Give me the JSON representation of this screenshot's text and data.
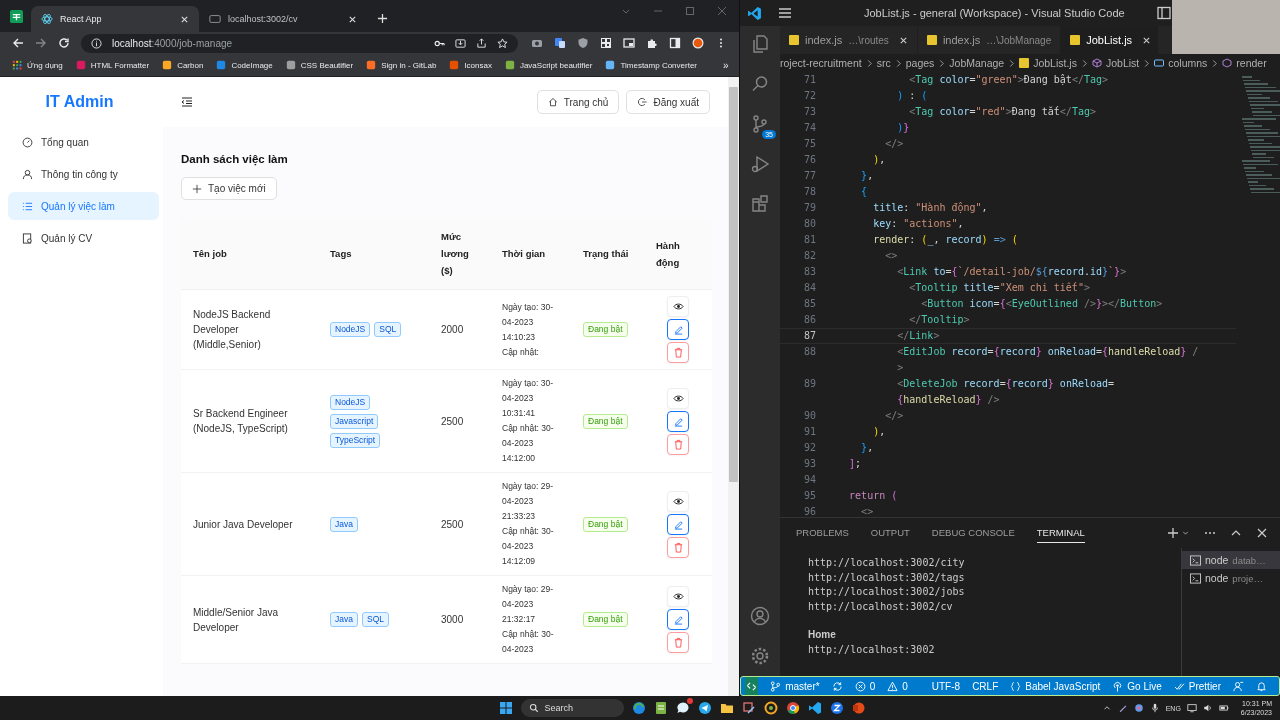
{
  "browser": {
    "tabs": [
      {
        "title": "React App",
        "selected": true
      },
      {
        "title": "localhost:3002/cv",
        "selected": false
      }
    ],
    "address": {
      "host": "localhost",
      "path": ":4000/job-manage"
    },
    "bookmarks": [
      "Ứng dụng",
      "HTML Formatter",
      "Carbon",
      "CodeImage",
      "CSS Beautifier",
      "Sign in - GitLab",
      "Iconsax",
      "JavaScript beautifier",
      "Timestamp Converter"
    ],
    "bookmarks_more": "»"
  },
  "app": {
    "logo": "IT Admin",
    "header_buttons": [
      "Trang chủ",
      "Đăng xuất"
    ],
    "sidebar": [
      {
        "label": "Tổng quan",
        "selected": false
      },
      {
        "label": "Thông tin công ty",
        "selected": false
      },
      {
        "label": "Quản lý việc làm",
        "selected": true
      },
      {
        "label": "Quản lý CV",
        "selected": false
      }
    ],
    "title": "Danh sách việc làm",
    "create_button": "Tạo việc mới",
    "table": {
      "columns": [
        "Tên job",
        "Tags",
        "Mức lương ($)",
        "Thời gian",
        "Trạng thái",
        "Hành động"
      ],
      "rows": [
        {
          "name": "NodeJS Backend Developer (Middle,Senior)",
          "tags": [
            "NodeJS",
            "SQL"
          ],
          "salary": "2000",
          "created": "Ngày tạo: 30-04-2023 14:10:23",
          "updated": "Cập nhật:",
          "status": "Đang bật",
          "enabled": true
        },
        {
          "name": "Sr Backend Engineer (NodeJS, TypeScript)",
          "tags": [
            "NodeJS",
            "Javascript",
            "TypeScript"
          ],
          "salary": "2500",
          "created": "Ngày tạo: 30-04-2023 10:31:41",
          "updated": "Cập nhật: 30-04-2023 14:12:00",
          "status": "Đang bật",
          "enabled": true
        },
        {
          "name": "Junior Java Developer",
          "tags": [
            "Java"
          ],
          "salary": "2500",
          "created": "Ngày tạo: 29-04-2023 21:33:23",
          "updated": "Cập nhật: 30-04-2023 14:12:09",
          "status": "Đang bật",
          "enabled": true
        },
        {
          "name": "Middle/Senior Java Developer",
          "tags": [
            "Java",
            "SQL"
          ],
          "salary": "3000",
          "created": "Ngày tạo: 29-04-2023 21:32:17",
          "updated": "Cập nhật: 30-04-2023",
          "status": "Đang bật",
          "enabled": true
        }
      ]
    }
  },
  "vscode": {
    "title": "JobList.js - general (Workspace) - Visual Studio Code",
    "scm_badge": "35",
    "tabs": [
      {
        "name": "index.js",
        "path": "…\\routes",
        "selected": false,
        "close_visible": true
      },
      {
        "name": "index.js",
        "path": "…\\JobManage",
        "selected": false,
        "close_visible": false
      },
      {
        "name": "JobList.js",
        "selected": true,
        "close_visible": true
      }
    ],
    "breadcrumb": [
      "roject-recruitment",
      "src",
      "pages",
      "JobManage",
      "JobList.js",
      "JobList",
      "columns",
      "render"
    ],
    "code": [
      {
        "number": "71",
        "current": false,
        "segments": [
          {
            "kind": "p",
            "text": "              <"
          },
          {
            "kind": "tag",
            "text": "Tag"
          },
          {
            "kind": "attr",
            "text": " color"
          },
          {
            "kind": "t",
            "text": "="
          },
          {
            "kind": "str",
            "text": "\"green\""
          },
          {
            "kind": "p",
            "text": ">"
          },
          {
            "kind": "t",
            "text": "Đang bật"
          },
          {
            "kind": "p",
            "text": "</"
          },
          {
            "kind": "tag",
            "text": "Tag"
          },
          {
            "kind": "p",
            "text": ">"
          }
        ]
      },
      {
        "number": "72",
        "current": false,
        "segments": [
          {
            "kind": "b3",
            "text": "            )"
          },
          {
            "kind": "t",
            "text": " : "
          },
          {
            "kind": "b3",
            "text": "("
          }
        ]
      },
      {
        "number": "73",
        "current": false,
        "segments": [
          {
            "kind": "p",
            "text": "              <"
          },
          {
            "kind": "tag",
            "text": "Tag"
          },
          {
            "kind": "attr",
            "text": " color"
          },
          {
            "kind": "t",
            "text": "="
          },
          {
            "kind": "str",
            "text": "\"red\""
          },
          {
            "kind": "p",
            "text": ">"
          },
          {
            "kind": "t",
            "text": "Đang tắt"
          },
          {
            "kind": "p",
            "text": "</"
          },
          {
            "kind": "tag",
            "text": "Tag"
          },
          {
            "kind": "p",
            "text": ">"
          }
        ]
      },
      {
        "number": "74",
        "current": false,
        "segments": [
          {
            "kind": "b3",
            "text": "            )"
          },
          {
            "kind": "b2",
            "text": "}"
          }
        ]
      },
      {
        "number": "75",
        "current": false,
        "segments": [
          {
            "kind": "p",
            "text": "          </>"
          }
        ]
      },
      {
        "number": "76",
        "current": false,
        "segments": [
          {
            "kind": "b1",
            "text": "        )"
          },
          {
            "kind": "t",
            "text": ","
          }
        ]
      },
      {
        "number": "77",
        "current": false,
        "segments": [
          {
            "kind": "b3",
            "text": "      }"
          },
          {
            "kind": "t",
            "text": ","
          }
        ]
      },
      {
        "number": "78",
        "current": false,
        "segments": [
          {
            "kind": "b3",
            "text": "      {"
          }
        ]
      },
      {
        "number": "79",
        "current": false,
        "segments": [
          {
            "kind": "attr",
            "text": "        title"
          },
          {
            "kind": "t",
            "text": ": "
          },
          {
            "kind": "str",
            "text": "\"Hành động\""
          },
          {
            "kind": "t",
            "text": ","
          }
        ]
      },
      {
        "number": "80",
        "current": false,
        "segments": [
          {
            "kind": "attr",
            "text": "        key"
          },
          {
            "kind": "t",
            "text": ": "
          },
          {
            "kind": "str",
            "text": "\"actions\""
          },
          {
            "kind": "t",
            "text": ","
          }
        ]
      },
      {
        "number": "81",
        "current": false,
        "segments": [
          {
            "kind": "fn",
            "text": "        render"
          },
          {
            "kind": "t",
            "text": ": "
          },
          {
            "kind": "b1",
            "text": "("
          },
          {
            "kind": "v",
            "text": "_"
          },
          {
            "kind": "t",
            "text": ", "
          },
          {
            "kind": "v",
            "text": "record"
          },
          {
            "kind": "b1",
            "text": ")"
          },
          {
            "kind": "kwb",
            "text": " =>"
          },
          {
            "kind": "b1",
            "text": " ("
          }
        ]
      },
      {
        "number": "82",
        "current": false,
        "segments": [
          {
            "kind": "p",
            "text": "          <>"
          }
        ]
      },
      {
        "number": "83",
        "current": false,
        "segments": [
          {
            "kind": "p",
            "text": "            <"
          },
          {
            "kind": "tag",
            "text": "Link"
          },
          {
            "kind": "attr",
            "text": " to"
          },
          {
            "kind": "t",
            "text": "="
          },
          {
            "kind": "b2",
            "text": "{"
          },
          {
            "kind": "str",
            "text": "`/detail-job/"
          },
          {
            "kind": "kwb",
            "text": "${"
          },
          {
            "kind": "v",
            "text": "record"
          },
          {
            "kind": "t",
            "text": "."
          },
          {
            "kind": "v",
            "text": "id"
          },
          {
            "kind": "kwb",
            "text": "}"
          },
          {
            "kind": "str",
            "text": "`"
          },
          {
            "kind": "b2",
            "text": "}"
          },
          {
            "kind": "p",
            "text": ">"
          }
        ]
      },
      {
        "number": "84",
        "current": false,
        "segments": [
          {
            "kind": "p",
            "text": "              <"
          },
          {
            "kind": "tag",
            "text": "Tooltip"
          },
          {
            "kind": "attr",
            "text": " title"
          },
          {
            "kind": "t",
            "text": "="
          },
          {
            "kind": "str",
            "text": "\"Xem chi tiết\""
          },
          {
            "kind": "p",
            "text": ">"
          }
        ]
      },
      {
        "number": "85",
        "current": false,
        "segments": [
          {
            "kind": "p",
            "text": "                <"
          },
          {
            "kind": "tag",
            "text": "Button"
          },
          {
            "kind": "attr",
            "text": " icon"
          },
          {
            "kind": "t",
            "text": "="
          },
          {
            "kind": "b2",
            "text": "{"
          },
          {
            "kind": "p",
            "text": "<"
          },
          {
            "kind": "tag",
            "text": "EyeOutlined"
          },
          {
            "kind": "p",
            "text": " />"
          },
          {
            "kind": "b2",
            "text": "}"
          },
          {
            "kind": "p",
            "text": "></"
          },
          {
            "kind": "tag",
            "text": "Button"
          },
          {
            "kind": "p",
            "text": ">"
          }
        ]
      },
      {
        "number": "86",
        "current": false,
        "segments": [
          {
            "kind": "p",
            "text": "              </"
          },
          {
            "kind": "tag",
            "text": "Tooltip"
          },
          {
            "kind": "p",
            "text": ">"
          }
        ]
      },
      {
        "number": "87",
        "current": true,
        "segments": [
          {
            "kind": "p",
            "text": "            </"
          },
          {
            "kind": "tag",
            "text": "Link"
          },
          {
            "kind": "p",
            "text": ">"
          }
        ]
      },
      {
        "number": "88",
        "current": false,
        "segments": [
          {
            "kind": "p",
            "text": "            <"
          },
          {
            "kind": "tag",
            "text": "EditJob"
          },
          {
            "kind": "attr",
            "text": " record"
          },
          {
            "kind": "t",
            "text": "="
          },
          {
            "kind": "b2",
            "text": "{"
          },
          {
            "kind": "v",
            "text": "record"
          },
          {
            "kind": "b2",
            "text": "}"
          },
          {
            "kind": "attr",
            "text": " onReload"
          },
          {
            "kind": "t",
            "text": "="
          },
          {
            "kind": "b2",
            "text": "{"
          },
          {
            "kind": "fn",
            "text": "handleReload"
          },
          {
            "kind": "b2",
            "text": "}"
          },
          {
            "kind": "p",
            "text": " /"
          }
        ],
        "wrap": [
          {
            "kind": "p",
            "text": "            >"
          }
        ]
      },
      {
        "number": "89",
        "current": false,
        "segments": [
          {
            "kind": "p",
            "text": "            <"
          },
          {
            "kind": "tag",
            "text": "DeleteJob"
          },
          {
            "kind": "attr",
            "text": " record"
          },
          {
            "kind": "t",
            "text": "="
          },
          {
            "kind": "b2",
            "text": "{"
          },
          {
            "kind": "v",
            "text": "record"
          },
          {
            "kind": "b2",
            "text": "}"
          },
          {
            "kind": "attr",
            "text": " onReload"
          },
          {
            "kind": "t",
            "text": "="
          }
        ],
        "wrap": [
          {
            "kind": "b2",
            "text": "            {"
          },
          {
            "kind": "fn",
            "text": "handleReload"
          },
          {
            "kind": "b2",
            "text": "}"
          },
          {
            "kind": "p",
            "text": " />"
          }
        ]
      },
      {
        "number": "90",
        "current": false,
        "segments": [
          {
            "kind": "p",
            "text": "          </>"
          }
        ]
      },
      {
        "number": "91",
        "current": false,
        "segments": [
          {
            "kind": "b1",
            "text": "        )"
          },
          {
            "kind": "t",
            "text": ","
          }
        ]
      },
      {
        "number": "92",
        "current": false,
        "segments": [
          {
            "kind": "b3",
            "text": "      }"
          },
          {
            "kind": "t",
            "text": ","
          }
        ]
      },
      {
        "number": "93",
        "current": false,
        "segments": [
          {
            "kind": "b2",
            "text": "    ]"
          },
          {
            "kind": "t",
            "text": ";"
          }
        ]
      },
      {
        "number": "94",
        "current": false
      },
      {
        "number": "95",
        "current": false,
        "segments": [
          {
            "kind": "kw",
            "text": "    return"
          },
          {
            "kind": "b2",
            "text": " ("
          }
        ]
      },
      {
        "number": "96",
        "current": false,
        "segments": [
          {
            "kind": "p",
            "text": "      <>"
          }
        ]
      }
    ],
    "panel": {
      "tabs": [
        {
          "label": "PROBLEMS",
          "selected": false
        },
        {
          "label": "OUTPUT",
          "selected": false
        },
        {
          "label": "DEBUG CONSOLE",
          "selected": false
        },
        {
          "label": "TERMINAL",
          "selected": true
        }
      ],
      "terminal_lines": [
        {
          "kind": "output",
          "text": "http://localhost:3002/city"
        },
        {
          "kind": "output",
          "text": "http://localhost:3002/tags"
        },
        {
          "kind": "output",
          "text": "http://localhost:3002/jobs"
        },
        {
          "kind": "output",
          "text": "http://localhost:3002/cv"
        },
        {
          "kind": "heading",
          "text": "Home"
        },
        {
          "kind": "output",
          "text": "http://localhost:3002"
        }
      ],
      "terminals": [
        {
          "name": "node",
          "detail": "datab…",
          "selected": true
        },
        {
          "name": "node",
          "detail": "proje…",
          "selected": false
        }
      ]
    },
    "status_bar": {
      "branch": "master*",
      "errors": "0",
      "warnings": "0",
      "encoding": "UTF-8",
      "eol": "CRLF",
      "language": "Babel JavaScript",
      "go_live": "Go Live",
      "formatter": "Prettier"
    }
  },
  "taskbar": {
    "search": "Search",
    "language": "ENG",
    "time": "10:31 PM",
    "date": "6/23/2023"
  }
}
